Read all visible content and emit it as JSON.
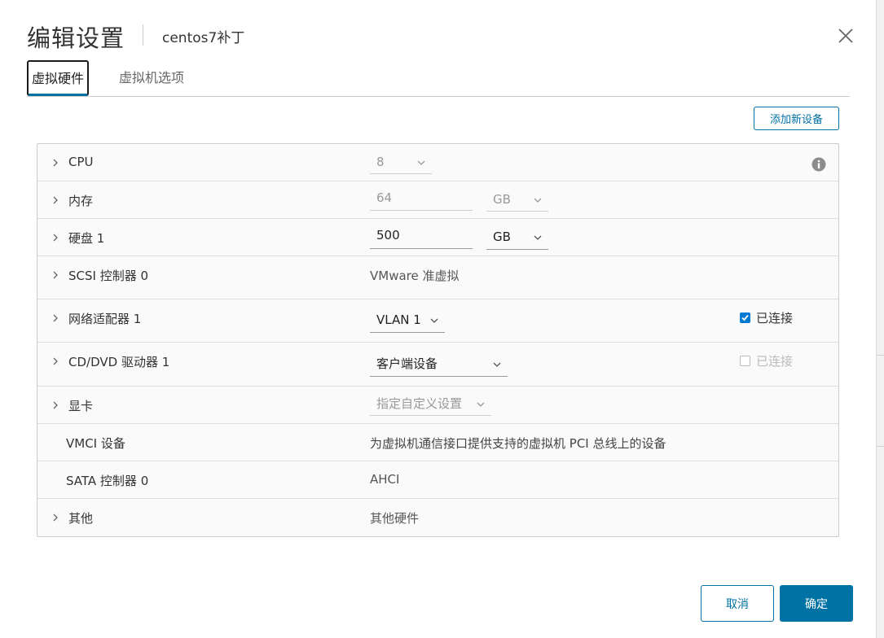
{
  "dialog": {
    "title": "编辑设置",
    "subtitle": "centos7补丁"
  },
  "tabs": [
    {
      "label": "虚拟硬件",
      "active": true
    },
    {
      "label": "虚拟机选项",
      "active": false
    }
  ],
  "toolbar": {
    "add_device_label": "添加新设备"
  },
  "hardware": {
    "cpu": {
      "label": "CPU",
      "value": "8"
    },
    "memory": {
      "label": "内存",
      "value": "64",
      "unit": "GB"
    },
    "disk": {
      "label": "硬盘 1",
      "value": "500",
      "unit": "GB"
    },
    "scsi": {
      "label": "SCSI 控制器 0",
      "value": "VMware 准虚拟"
    },
    "network": {
      "label": "网络适配器 1",
      "value": "VLAN 1",
      "connected_label": "已连接",
      "connected": true
    },
    "cddvd": {
      "label": "CD/DVD 驱动器 1",
      "value": "客户端设备",
      "connected_label": "已连接",
      "connected": false
    },
    "video": {
      "label": "显卡",
      "value": "指定自定义设置"
    },
    "vmci": {
      "label": "VMCI 设备",
      "value": "为虚拟机通信接口提供支持的虚拟机 PCI 总线上的设备"
    },
    "sata": {
      "label": "SATA 控制器 0",
      "value": "AHCI"
    },
    "other": {
      "label": "其他",
      "value": "其他硬件"
    }
  },
  "footer": {
    "cancel_label": "取消",
    "ok_label": "确定"
  },
  "colors": {
    "accent": "#0072a3",
    "checkbox": "#0079d3"
  }
}
